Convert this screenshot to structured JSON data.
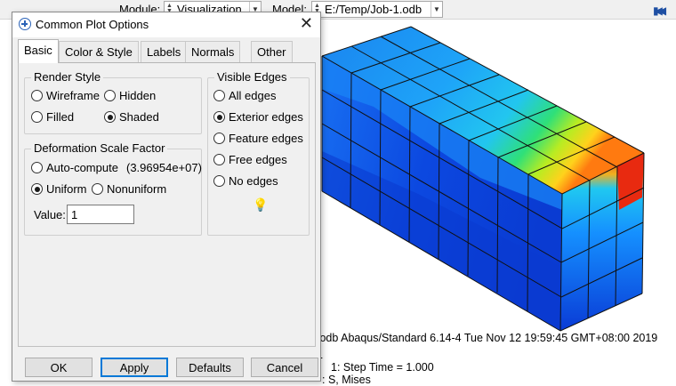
{
  "toolbar": {
    "module_label": "Module:",
    "module_value": "Visualization",
    "model_label": "Model:",
    "model_value": "E:/Temp/Job-1.odb",
    "rewind_icon": "rewind-to-first-icon"
  },
  "viewport": {
    "info_line": ".odb    Abaqus/Standard 6.14-4    Tue Nov 12 19:59:45 GMT+08:00 2019",
    "frame_number": "1",
    "step_time": "1: Step Time =     1.000",
    "variable": ": S, Mises"
  },
  "dialog": {
    "title": "Common Plot Options",
    "tabs": [
      {
        "label": "Basic",
        "active": true
      },
      {
        "label": "Color & Style",
        "active": false
      },
      {
        "label": "Labels",
        "active": false
      },
      {
        "label": "Normals",
        "active": false
      },
      {
        "label": "Other",
        "active": false
      }
    ],
    "render_style": {
      "title": "Render Style",
      "options": [
        {
          "label": "Wireframe",
          "selected": false
        },
        {
          "label": "Hidden",
          "selected": false
        },
        {
          "label": "Filled",
          "selected": false
        },
        {
          "label": "Shaded",
          "selected": true
        }
      ]
    },
    "deformation": {
      "title": "Deformation Scale Factor",
      "auto_label": "Auto-compute",
      "auto_value": "(3.96954e+07)",
      "uniform_label": "Uniform",
      "nonuniform_label": "Nonuniform",
      "value_label": "Value:",
      "value": "1",
      "selected": "uniform"
    },
    "visible_edges": {
      "title": "Visible Edges",
      "options": [
        {
          "label": "All edges",
          "selected": false
        },
        {
          "label": "Exterior edges",
          "selected": true
        },
        {
          "label": "Feature edges",
          "selected": false
        },
        {
          "label": "Free edges",
          "selected": false
        },
        {
          "label": "No edges",
          "selected": false
        }
      ],
      "hint_icon": "lightbulb-icon"
    },
    "buttons": {
      "ok": "OK",
      "apply": "Apply",
      "defaults": "Defaults",
      "cancel": "Cancel"
    }
  },
  "colors": {
    "contour_dark_blue": "#0a3fd6",
    "contour_blue": "#1060ff",
    "contour_cyan": "#19b4ff",
    "contour_green": "#2ee070",
    "contour_yellow": "#ffe020",
    "contour_red": "#e82010",
    "accent": "#0078d7"
  }
}
